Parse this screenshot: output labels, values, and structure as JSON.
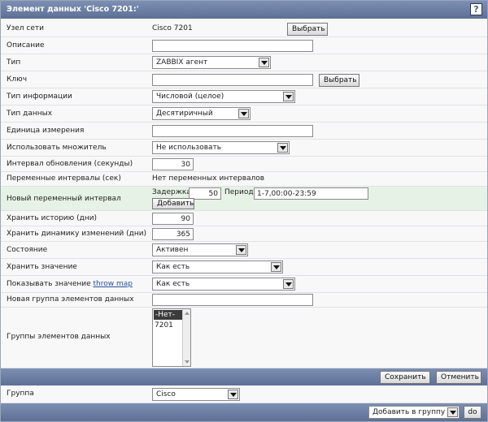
{
  "title": "Элемент данных 'Cisco 7201:'",
  "help": "?",
  "host": {
    "label": "Узел сети",
    "value": "Cisco 7201",
    "button": "Выбрать"
  },
  "description": {
    "label": "Описание",
    "value": ""
  },
  "type": {
    "label": "Тип",
    "value": "ZABBIX агент"
  },
  "key": {
    "label": "Ключ",
    "value": "",
    "button": "Выбрать"
  },
  "info_type": {
    "label": "Тип информации",
    "value": "Числовой (целое)"
  },
  "data_type": {
    "label": "Тип данных",
    "value": "Десятиричный"
  },
  "units": {
    "label": "Единица измерения",
    "value": ""
  },
  "multiplier": {
    "label": "Использовать множитель",
    "value": "Не использовать"
  },
  "interval": {
    "label": "Интервал обновления (секунды)",
    "value": "30"
  },
  "flex_intervals": {
    "label": "Переменные интервалы (сек)",
    "value": "Нет переменных интервалов"
  },
  "new_flex": {
    "label": "Новый переменный интервал",
    "delay_label": "Задержка",
    "delay_value": "50",
    "period_label": "Период",
    "period_value": "1-7,00:00-23:59",
    "add_button": "Добавить"
  },
  "history": {
    "label": "Хранить историю (дни)",
    "value": "90"
  },
  "trends": {
    "label": "Хранить динамику изменений (дни)",
    "value": "365"
  },
  "status": {
    "label": "Состояние",
    "value": "Активен"
  },
  "store_value": {
    "label": "Хранить значение",
    "value": "Как есть"
  },
  "show_value": {
    "label": "Показывать значение",
    "link": "throw map",
    "value": "Как есть"
  },
  "new_group": {
    "label": "Новая группа элементов данных",
    "value": ""
  },
  "groups": {
    "label": "Группы элементов данных",
    "options": [
      "-Нет-",
      "7201"
    ]
  },
  "actions": {
    "save": "Сохранить",
    "cancel": "Отменить"
  },
  "group": {
    "label": "Группа",
    "value": "Cisco"
  },
  "footer": {
    "add_to_group": "Добавить в группу",
    "do": "do"
  }
}
